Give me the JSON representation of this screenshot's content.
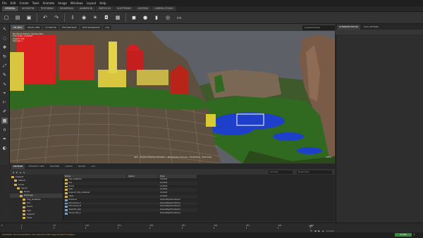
{
  "menu": [
    "File",
    "Edit",
    "Create",
    "Tools",
    "Animate",
    "Image",
    "Windows",
    "Layout",
    "Help"
  ],
  "workspace_tabs": [
    {
      "label": "GENERAL",
      "active": true
    },
    {
      "label": "GEOMETRY",
      "active": false
    },
    {
      "label": "TEXTURING",
      "active": false
    },
    {
      "label": "RENDERING",
      "active": false
    },
    {
      "label": "ANIMATION",
      "active": false
    },
    {
      "label": "PARTICLES",
      "active": false
    },
    {
      "label": "SCATTERING",
      "active": false
    },
    {
      "label": "LIGHTING",
      "active": false
    },
    {
      "label": "CAMERA STUDIO",
      "active": false
    }
  ],
  "toolbar_icons": [
    "new-file-icon",
    "open-icon",
    "save-icon",
    "undo-icon",
    "redo-icon",
    "import-icon",
    "render-icon",
    "light-icon",
    "camera-icon",
    "grid-icon",
    "cube-icon",
    "sphere-icon",
    "cylinder-icon",
    "torus-icon",
    "plane-icon"
  ],
  "viewport": {
    "modes": [
      {
        "label": "3D VIEW",
        "active": true
      },
      {
        "label": "IMAGE VIEW",
        "active": false
      },
      {
        "label": "UV EDITOR",
        "active": false
      },
      {
        "label": "TEXTURE BAKE",
        "active": false
      },
      {
        "label": "PATH WORKSHOP",
        "active": false
      },
      {
        "label": "LOG",
        "active": false
      }
    ],
    "scene_select": "project1/scene",
    "info_lines": [
      "Rendering Camera: Camera_Main",
      "Total Polys: 1,234,567",
      "Objects: 248",
      "Selected: 1"
    ],
    "status": "GPU - Simple Shading (Smooth) • Perspective Camera • Wireframe - Free View",
    "zoom": "100%"
  },
  "right_panel": {
    "tabs": [
      {
        "label": "ATTRIBUTE EDITOR",
        "active": true
      },
      {
        "label": "TOOL OPTIONS",
        "active": false
      }
    ],
    "subheader": ""
  },
  "browser": {
    "tabs": [
      {
        "label": "BROWSER",
        "active": true
      },
      {
        "label": "HIERARCHY VIEW",
        "active": false
      },
      {
        "label": "EXPLORER",
        "active": false
      },
      {
        "label": "CANVAS",
        "active": false
      },
      {
        "label": "SEARCH",
        "active": false
      },
      {
        "label": "LOG",
        "active": false
      }
    ],
    "filter": "List View",
    "search_placeholder": "Project Root",
    "tree": [
      {
        "label": "project1",
        "indent": 0
      },
      {
        "label": "default",
        "indent": 1
      },
      {
        "label": "scene",
        "indent": 1
      },
      {
        "label": "layout",
        "indent": 2
      },
      {
        "label": "Rocks",
        "indent": 3
      },
      {
        "label": "Buildings",
        "indent": 3,
        "selected": true
      },
      {
        "label": "City_Scatterer",
        "indent": 4
      },
      {
        "label": "Env",
        "indent": 4
      },
      {
        "label": "Rocks",
        "indent": 4
      },
      {
        "label": "Sets",
        "indent": 4
      },
      {
        "label": "Support",
        "indent": 4
      },
      {
        "label": "Trees",
        "indent": 4
      },
      {
        "label": "Support_City_Scatterer",
        "indent": 4
      }
    ],
    "columns": [
      "Name",
      "Owner",
      "Type"
    ],
    "rows": [
      {
        "name": "City_Scatterer",
        "owner": "",
        "type": "Context",
        "kind": "folder"
      },
      {
        "name": "Env",
        "owner": "",
        "type": "Context",
        "kind": "folder"
      },
      {
        "name": "Rocks",
        "owner": "",
        "type": "Context",
        "kind": "folder"
      },
      {
        "name": "Sets",
        "owner": "",
        "type": "Context",
        "kind": "folder"
      },
      {
        "name": "Support_City_Scatterer",
        "owner": "",
        "type": "Context",
        "kind": "folder"
      },
      {
        "name": "Trees",
        "owner": "",
        "type": "Context",
        "kind": "folder"
      },
      {
        "name": "Entrance",
        "owner": "",
        "type": "SceneObjectCombiner",
        "kind": "obj"
      },
      {
        "name": "Monument_A",
        "owner": "",
        "type": "SceneObjectCombiner",
        "kind": "obj"
      },
      {
        "name": "Monument_B",
        "owner": "",
        "type": "SceneObjectCombiner",
        "kind": "obj"
      },
      {
        "name": "Tower01_LR2",
        "owner": "",
        "type": "SceneObjectCombiner",
        "kind": "obj"
      },
      {
        "name": "Tunnel_Tall_A",
        "owner": "",
        "type": "SceneObjectCombiner",
        "kind": "obj"
      }
    ]
  },
  "timeline": {
    "frame": "1",
    "ticks": [
      "1",
      "51",
      "101",
      "151",
      "201",
      "251",
      "301",
      "351",
      "401",
      "451"
    ],
    "end_frame": "501",
    "current_label": "Current",
    "end_value": "24.0 fps"
  },
  "status": {
    "message": "PolyMesh: the triangulation has detected 240 degenerated triangles.",
    "memory": "12 GB",
    "colors": {
      "memory_ok": "#3a8a3a",
      "warning": "#d0a050"
    }
  }
}
